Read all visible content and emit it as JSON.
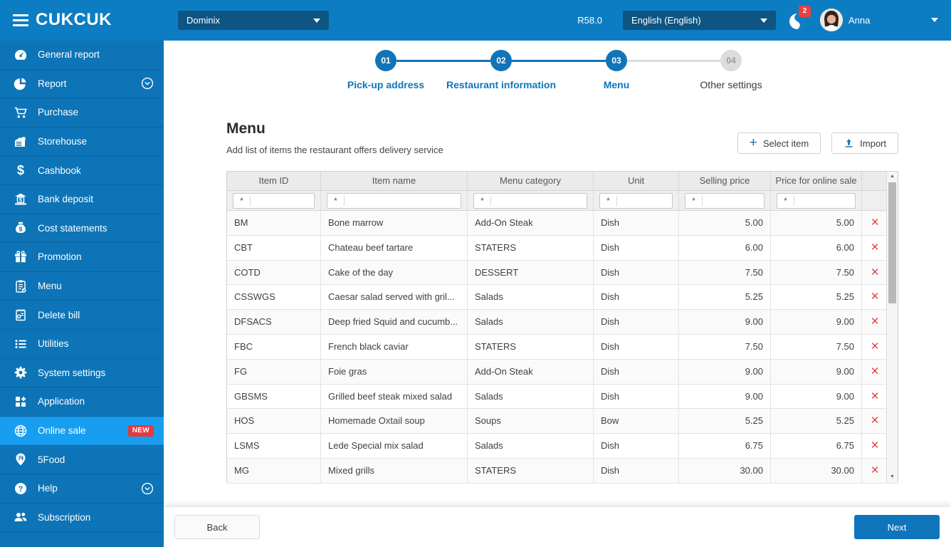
{
  "topbar": {
    "logo": "CUKCUK",
    "branch": "Dominix",
    "version": "R58.0",
    "language": "English (English)",
    "notification_count": "2",
    "user_name": "Anna"
  },
  "sidebar": {
    "items": [
      {
        "label": "General report",
        "icon": "gauge-icon"
      },
      {
        "label": "Report",
        "icon": "pie-chart-icon",
        "expandable": true
      },
      {
        "label": "Purchase",
        "icon": "cart-icon"
      },
      {
        "label": "Storehouse",
        "icon": "warehouse-icon"
      },
      {
        "label": "Cashbook",
        "icon": "dollar-icon"
      },
      {
        "label": "Bank deposit",
        "icon": "bank-icon"
      },
      {
        "label": "Cost statements",
        "icon": "money-bag-icon"
      },
      {
        "label": "Promotion",
        "icon": "gift-icon"
      },
      {
        "label": "Menu",
        "icon": "clipboard-icon"
      },
      {
        "label": "Delete bill",
        "icon": "delete-bill-icon"
      },
      {
        "label": "Utilities",
        "icon": "list-icon"
      },
      {
        "label": "System settings",
        "icon": "gear-icon"
      },
      {
        "label": "Application",
        "icon": "apps-icon"
      },
      {
        "label": "Online sale",
        "icon": "globe-icon",
        "active": true,
        "badge": "NEW"
      },
      {
        "label": "5Food",
        "icon": "pin-icon"
      },
      {
        "label": "Help",
        "icon": "help-icon",
        "expandable": true
      },
      {
        "label": "Subscription",
        "icon": "people-icon"
      }
    ]
  },
  "stepper": {
    "steps": [
      {
        "number": "01",
        "label": "Pick-up address",
        "state": "done"
      },
      {
        "number": "02",
        "label": "Restaurant information",
        "state": "done"
      },
      {
        "number": "03",
        "label": "Menu",
        "state": "active"
      },
      {
        "number": "04",
        "label": "Other settings",
        "state": "upcoming"
      }
    ]
  },
  "page": {
    "title": "Menu",
    "subtitle": "Add list of items the restaurant offers delivery service",
    "select_item_button": "Select item",
    "import_button": "Import"
  },
  "table": {
    "columns": [
      "Item ID",
      "Item name",
      "Menu category",
      "Unit",
      "Selling price",
      "Price for online sale"
    ],
    "filter_symbol": "*",
    "delete_icon": "×",
    "rows": [
      {
        "id": "BM",
        "name": "Bone marrow",
        "category": "Add-On Steak",
        "unit": "Dish",
        "price": "5.00",
        "online_price": "5.00"
      },
      {
        "id": "CBT",
        "name": "Chateau beef tartare",
        "category": "STATERS",
        "unit": "Dish",
        "price": "6.00",
        "online_price": "6.00"
      },
      {
        "id": "COTD",
        "name": "Cake of the day",
        "category": "DESSERT",
        "unit": "Dish",
        "price": "7.50",
        "online_price": "7.50"
      },
      {
        "id": "CSSWGS",
        "name": "Caesar salad served with gril...",
        "category": "Salads",
        "unit": "Dish",
        "price": "5.25",
        "online_price": "5.25"
      },
      {
        "id": "DFSACS",
        "name": "Deep fried Squid and cucumb...",
        "category": "Salads",
        "unit": "Dish",
        "price": "9.00",
        "online_price": "9.00"
      },
      {
        "id": "FBC",
        "name": "French black caviar",
        "category": "STATERS",
        "unit": "Dish",
        "price": "7.50",
        "online_price": "7.50"
      },
      {
        "id": "FG",
        "name": "Foie gras",
        "category": "Add-On Steak",
        "unit": "Dish",
        "price": "9.00",
        "online_price": "9.00"
      },
      {
        "id": "GBSMS",
        "name": "Grilled beef steak mixed salad",
        "category": "Salads",
        "unit": "Dish",
        "price": "9.00",
        "online_price": "9.00"
      },
      {
        "id": "HOS",
        "name": "Homemade Oxtail soup",
        "category": "Soups",
        "unit": "Bow",
        "price": "5.25",
        "online_price": "5.25"
      },
      {
        "id": "LSMS",
        "name": "Lede Special mix salad",
        "category": "Salads",
        "unit": "Dish",
        "price": "6.75",
        "online_price": "6.75"
      },
      {
        "id": "MG",
        "name": "Mixed grills",
        "category": "STATERS",
        "unit": "Dish",
        "price": "30.00",
        "online_price": "30.00"
      }
    ]
  },
  "footer": {
    "back": "Back",
    "next": "Next"
  },
  "colors": {
    "topbar": "#0d7dc3",
    "sidebar": "#0d74b7",
    "active_item": "#189ef0",
    "accent": "#0e75bc",
    "badge_red": "#e23b3d",
    "delete_red": "#e4393c",
    "step_done": "#1274b8",
    "step_todo": "#dcdcdc"
  }
}
